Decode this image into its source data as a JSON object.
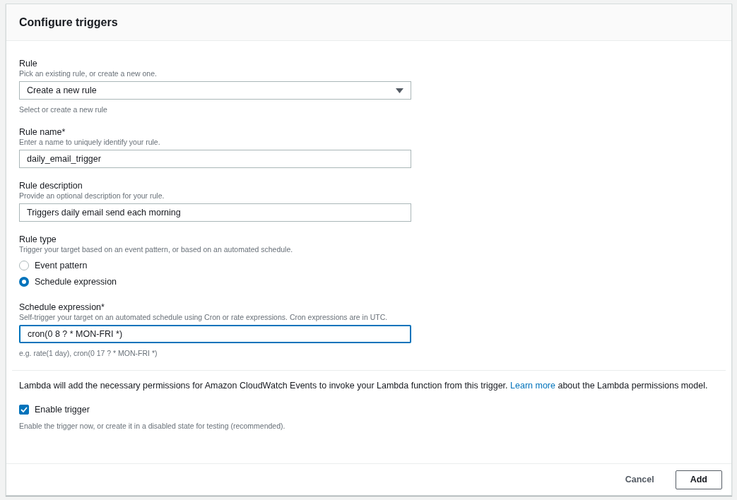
{
  "panel": {
    "title": "Configure triggers"
  },
  "fields": [
    {
      "kind": "select",
      "label": "Rule",
      "description": "Pick an existing rule, or create a new one.",
      "value": "Create a new rule",
      "hint": "Select or create a new rule",
      "focused": false
    },
    {
      "kind": "text",
      "label": "Rule name*",
      "description": "Enter a name to uniquely identify your rule.",
      "value": "daily_email_trigger",
      "focused": false
    },
    {
      "kind": "text",
      "label": "Rule description",
      "description": "Provide an optional description for your rule.",
      "value": "Triggers daily email send each morning",
      "focused": false
    },
    {
      "kind": "radio",
      "label": "Rule type",
      "description": "Trigger your target based on an event pattern, or based on an automated schedule.",
      "options": [
        {
          "label": "Event pattern",
          "selected": false
        },
        {
          "label": "Schedule expression",
          "selected": true
        }
      ]
    },
    {
      "kind": "text",
      "label": "Schedule expression*",
      "description": "Self-trigger your target on an automated schedule using Cron or rate expressions. Cron expressions are in UTC.",
      "value": "cron(0 8 ? * MON-FRI *)",
      "focused": true,
      "hint": "e.g. rate(1 day), cron(0 17 ? * MON-FRI *)"
    }
  ],
  "permissions_note": {
    "before": "Lambda will add the necessary permissions for Amazon CloudWatch Events to invoke your Lambda function from this trigger.",
    "link": "Learn more",
    "after": "about the Lambda permissions model."
  },
  "enable_trigger": {
    "label": "Enable trigger",
    "checked": true,
    "hint": "Enable the trigger now, or create it in a disabled state for testing (recommended)."
  },
  "buttons": [
    {
      "label": "Cancel",
      "kind": "link"
    },
    {
      "label": "Add",
      "kind": "outline"
    }
  ]
}
